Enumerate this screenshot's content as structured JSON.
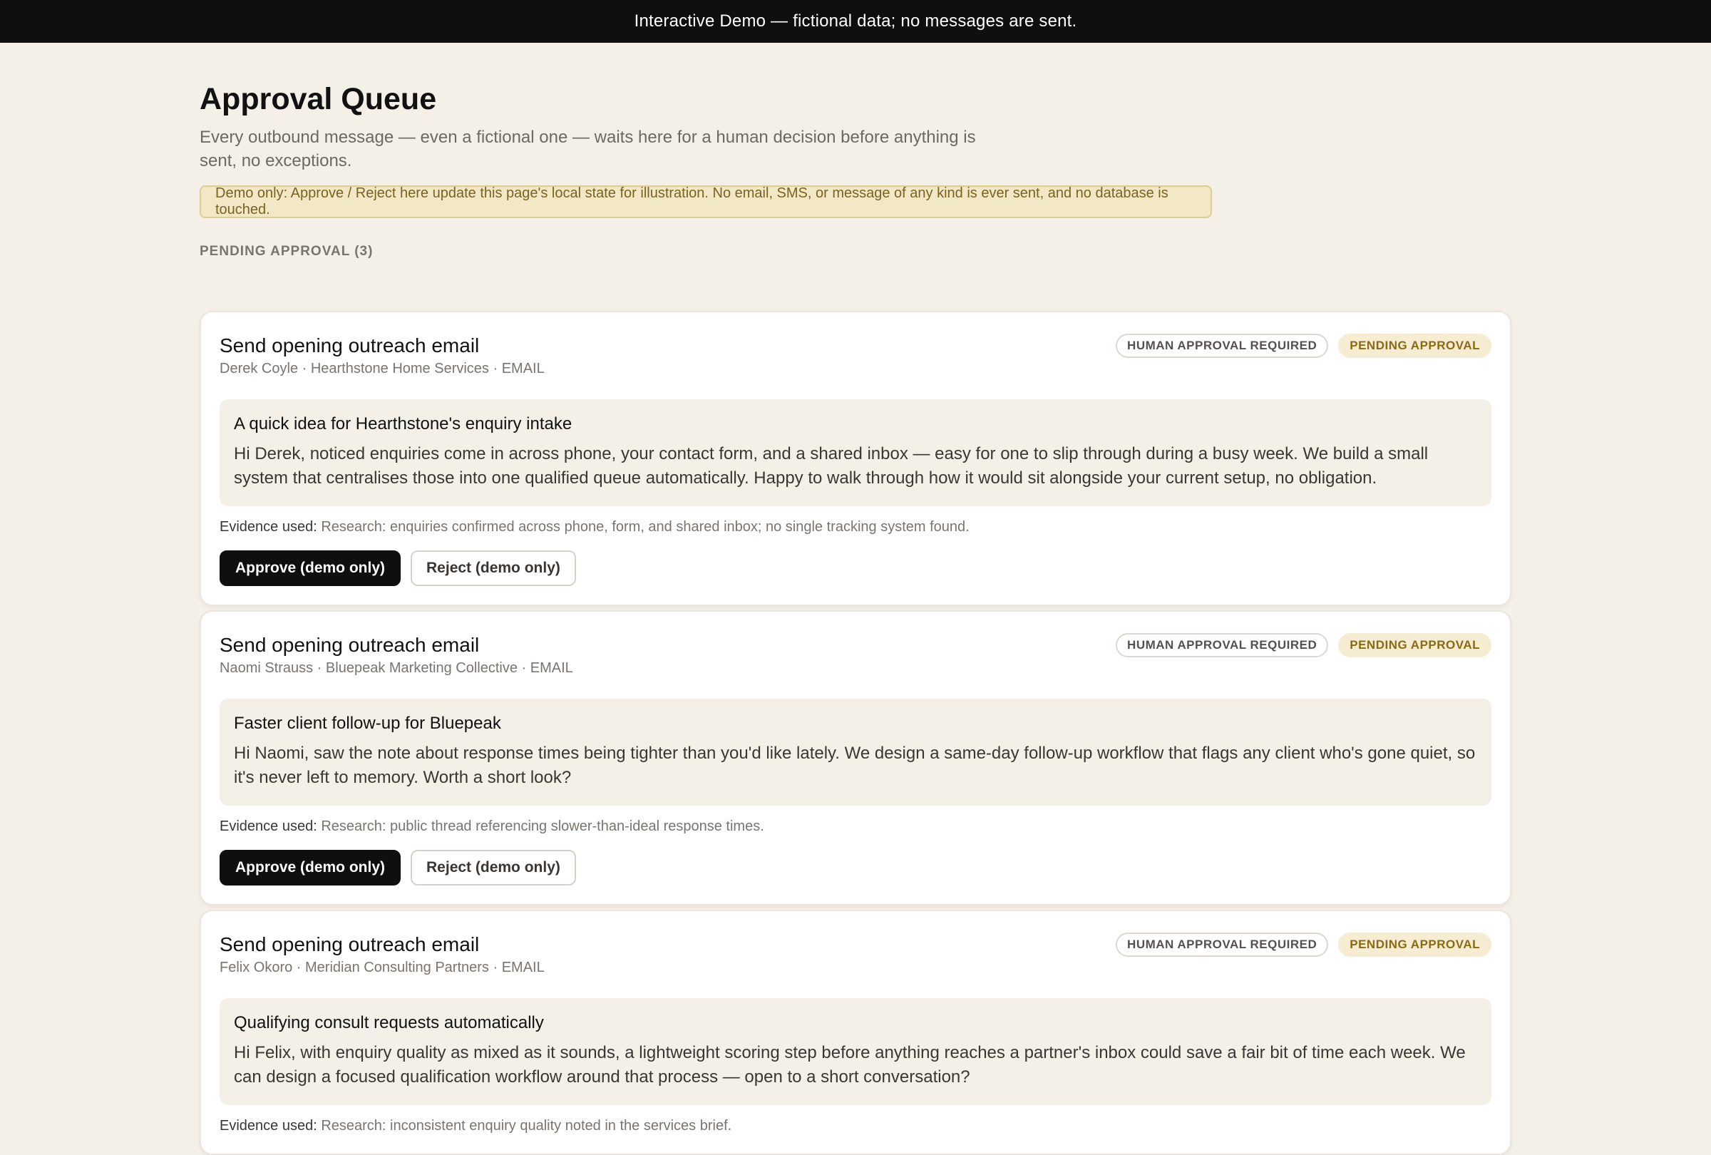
{
  "banner": "Interactive Demo — fictional data; no messages are sent.",
  "page": {
    "title": "Approval Queue",
    "subtitle": "Every outbound message — even a fictional one — waits here for a human decision before anything is sent, no exceptions.",
    "notice": "Demo only: Approve / Reject here update this page's local state for illustration. No email, SMS, or message of any kind is ever sent, and no database is touched.",
    "section_label": "PENDING APPROVAL (3)"
  },
  "labels": {
    "badge_human": "HUMAN APPROVAL REQUIRED",
    "badge_pending": "PENDING APPROVAL",
    "evidence_label": "Evidence used:",
    "approve": "Approve (demo only)",
    "reject": "Reject (demo only)"
  },
  "items": [
    {
      "title": "Send opening outreach email",
      "meta": "Derek Coyle · Hearthstone Home Services · EMAIL",
      "subject": "A quick idea for Hearthstone's enquiry intake",
      "body": "Hi Derek, noticed enquiries come in across phone, your contact form, and a shared inbox — easy for one to slip through during a busy week. We build a small system that centralises those into one qualified queue automatically. Happy to walk through how it would sit alongside your current setup, no obligation.",
      "evidence": "Research: enquiries confirmed across phone, form, and shared inbox; no single tracking system found."
    },
    {
      "title": "Send opening outreach email",
      "meta": "Naomi Strauss · Bluepeak Marketing Collective · EMAIL",
      "subject": "Faster client follow-up for Bluepeak",
      "body": "Hi Naomi, saw the note about response times being tighter than you'd like lately. We design a same-day follow-up workflow that flags any client who's gone quiet, so it's never left to memory. Worth a short look?",
      "evidence": "Research: public thread referencing slower-than-ideal response times."
    },
    {
      "title": "Send opening outreach email",
      "meta": "Felix Okoro · Meridian Consulting Partners · EMAIL",
      "subject": "Qualifying consult requests automatically",
      "body": "Hi Felix, with enquiry quality as mixed as it sounds, a lightweight scoring step before anything reaches a partner's inbox could save a fair bit of time each week. We can design a focused qualification workflow around that process — open to a short conversation?",
      "evidence": "Research: inconsistent enquiry quality noted in the services brief."
    }
  ]
}
